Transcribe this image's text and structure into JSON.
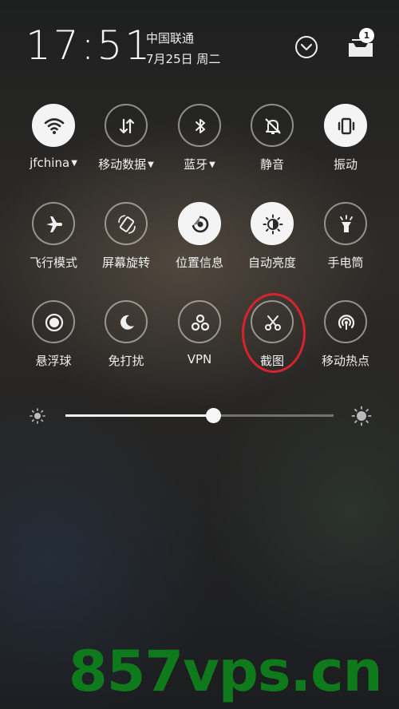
{
  "status": {
    "time": "17:51",
    "carrier": "中国联通",
    "date": "7月25日 周二",
    "notification_count": "1"
  },
  "tiles": [
    {
      "label": "jfchina",
      "icon": "wifi-icon",
      "on": true,
      "caret": true
    },
    {
      "label": "移动数据",
      "icon": "mobile-data-icon",
      "on": false,
      "caret": true
    },
    {
      "label": "蓝牙",
      "icon": "bluetooth-icon",
      "on": false,
      "caret": true
    },
    {
      "label": "静音",
      "icon": "mute-icon",
      "on": false,
      "caret": false
    },
    {
      "label": "振动",
      "icon": "vibrate-icon",
      "on": true,
      "caret": false
    },
    {
      "label": "飞行模式",
      "icon": "airplane-icon",
      "on": false,
      "caret": false
    },
    {
      "label": "屏幕旋转",
      "icon": "rotate-icon",
      "on": false,
      "caret": false
    },
    {
      "label": "位置信息",
      "icon": "location-icon",
      "on": true,
      "caret": false
    },
    {
      "label": "自动亮度",
      "icon": "auto-brightness-icon",
      "on": true,
      "caret": false
    },
    {
      "label": "手电筒",
      "icon": "flashlight-icon",
      "on": false,
      "caret": false
    },
    {
      "label": "悬浮球",
      "icon": "floating-ball-icon",
      "on": false,
      "caret": false
    },
    {
      "label": "免打扰",
      "icon": "moon-icon",
      "on": false,
      "caret": false
    },
    {
      "label": "VPN",
      "icon": "vpn-icon",
      "on": false,
      "caret": false
    },
    {
      "label": "截图",
      "icon": "scissors-icon",
      "on": false,
      "caret": false
    },
    {
      "label": "移动热点",
      "icon": "hotspot-icon",
      "on": false,
      "caret": false
    }
  ],
  "brightness": {
    "level": 0.55
  },
  "watermark": "857vps.cn"
}
